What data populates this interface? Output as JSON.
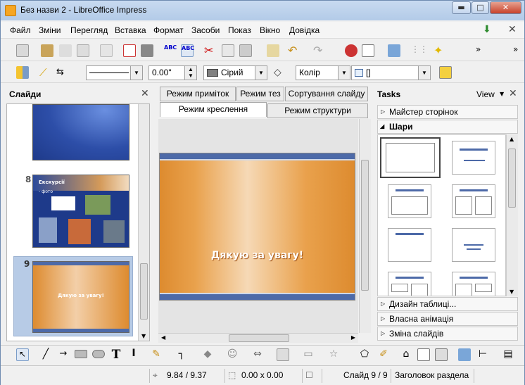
{
  "window": {
    "title": "Без назви 2 - LibreOffice Impress"
  },
  "menu": [
    "Файл",
    "Зміни",
    "Перегляд",
    "Вставка",
    "Формат",
    "Засоби",
    "Показ",
    "Вікно",
    "Довідка"
  ],
  "toolbar2": {
    "angle": "0.00\"",
    "fill_color": "Сірий",
    "area_type": "Колір",
    "pattern": "[]"
  },
  "slides_panel": {
    "title": "Слайди",
    "slides": [
      {
        "number": "8",
        "title": "Екскурсії",
        "bullet": "- фото"
      },
      {
        "number": "9",
        "text": "Дякую за увагу!"
      }
    ]
  },
  "center": {
    "tabs_row1": [
      "Режим приміток",
      "Режим тез",
      "Сортування слайду"
    ],
    "tabs_row2": [
      "Режим креслення",
      "Режим структури"
    ],
    "slide_text": "Дякую за увагу!"
  },
  "tasks": {
    "title": "Tasks",
    "view_label": "View",
    "sections": [
      "Майстер сторінок",
      "Шари",
      "Дизайн таблиці...",
      "Власна анімація",
      "Зміна слайдів"
    ]
  },
  "statusbar": {
    "position": "9.84 / 9.37",
    "size": "0.00 x 0.00",
    "slide": "Слайд 9 / 9",
    "layout": "Заголовок раздела"
  }
}
